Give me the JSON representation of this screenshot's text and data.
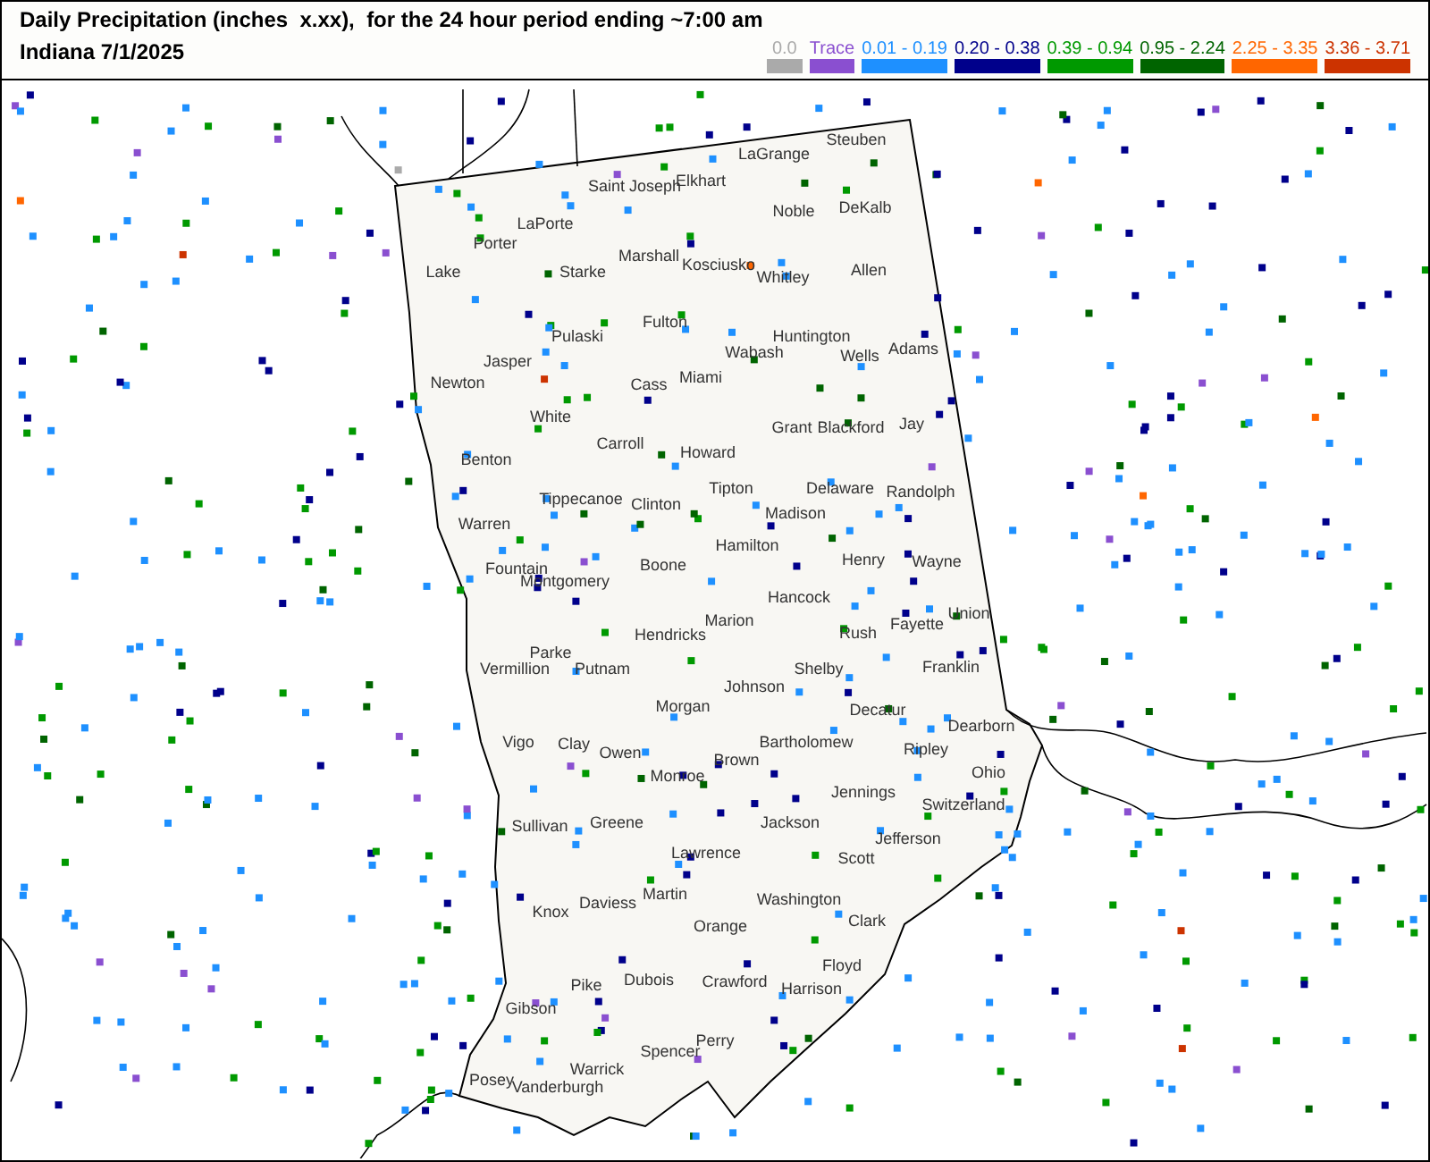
{
  "title": "Daily Precipitation (inches  x.xx),  for the 24 hour period ending ~7:00 am",
  "subtitle": "Indiana 7/1/2025",
  "legend": [
    {
      "label": "0.0",
      "color": "#aaaaaa"
    },
    {
      "label": "Trace",
      "color": "#8a4fd0"
    },
    {
      "label": "0.01 - 0.19",
      "color": "#1e90ff"
    },
    {
      "label": "0.20 - 0.38",
      "color": "#00008b"
    },
    {
      "label": "0.39 - 0.94",
      "color": "#009900"
    },
    {
      "label": "0.95 - 2.24",
      "color": "#006400"
    },
    {
      "label": "2.25 - 3.35",
      "color": "#ff6600"
    },
    {
      "label": "3.36 - 3.71",
      "color": "#cc3300"
    }
  ],
  "map": {
    "counties": [
      "Lake",
      "Porter",
      "LaPorte",
      "Saint Joseph",
      "Elkhart",
      "LaGrange",
      "Steuben",
      "Noble",
      "DeKalb",
      "Starke",
      "Marshall",
      "Kosciusko",
      "Whitley",
      "Allen",
      "Pulaski",
      "Fulton",
      "Wabash",
      "Huntington",
      "Wells",
      "Adams",
      "Newton",
      "Jasper",
      "White",
      "Cass",
      "Miami",
      "Grant",
      "Blackford",
      "Jay",
      "Carroll",
      "Howard",
      "Benton",
      "Tippecanoe",
      "Clinton",
      "Tipton",
      "Madison",
      "Delaware",
      "Randolph",
      "Warren",
      "Fountain",
      "Hamilton",
      "Henry",
      "Wayne",
      "Montgomery",
      "Boone",
      "Hancock",
      "Marion",
      "Fayette",
      "Union",
      "Vermillion",
      "Parke",
      "Putnam",
      "Hendricks",
      "Rush",
      "Shelby",
      "Johnson",
      "Franklin",
      "Morgan",
      "Decatur",
      "Vigo",
      "Clay",
      "Owen",
      "Monroe",
      "Brown",
      "Bartholomew",
      "Ripley",
      "Dearborn",
      "Ohio",
      "Jennings",
      "Switzerland",
      "Sullivan",
      "Greene",
      "Jackson",
      "Lawrence",
      "Jefferson",
      "Scott",
      "Knox",
      "Daviess",
      "Martin",
      "Washington",
      "Orange",
      "Clark",
      "Pike",
      "Dubois",
      "Crawford",
      "Floyd",
      "Harrison",
      "Gibson",
      "Perry",
      "Spencer",
      "Warrick",
      "Posey",
      "Vanderburgh"
    ]
  }
}
